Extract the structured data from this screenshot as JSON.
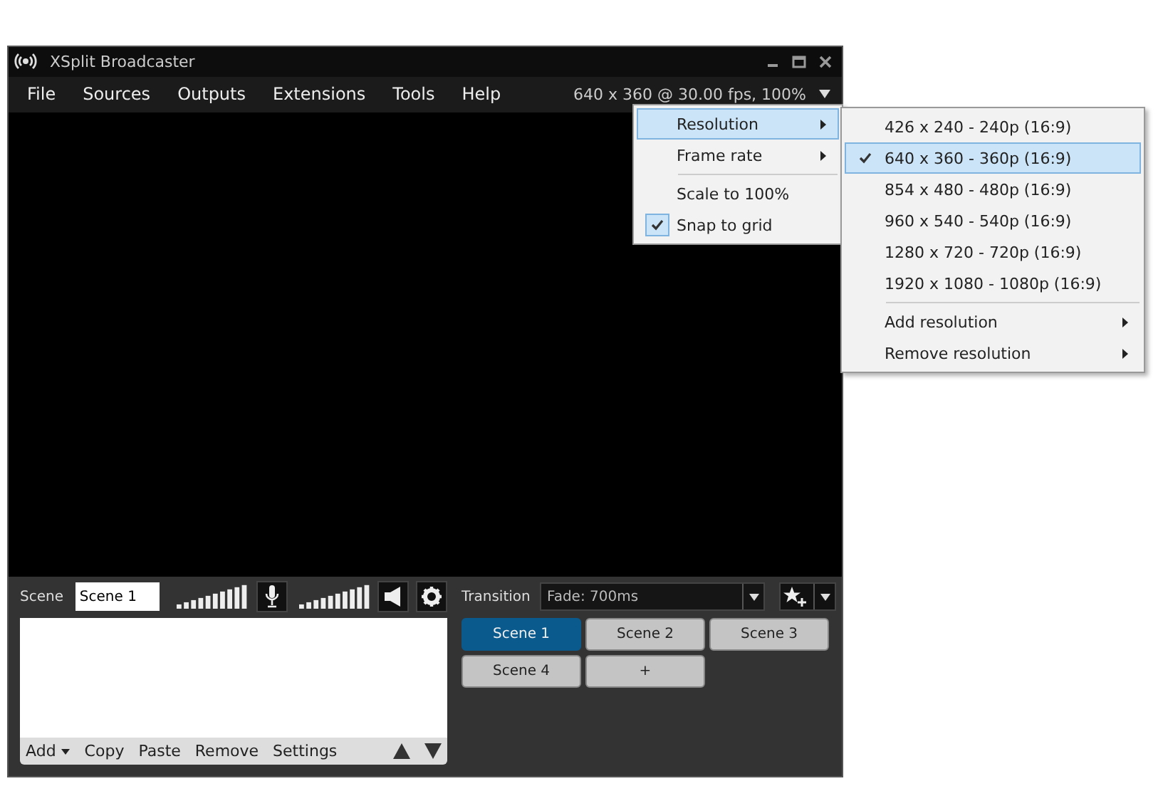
{
  "window": {
    "title": "XSplit Broadcaster"
  },
  "menu": [
    "File",
    "Sources",
    "Outputs",
    "Extensions",
    "Tools",
    "Help"
  ],
  "status": "640 x 360 @ 30.00 fps, 100%",
  "scene_bar": {
    "label": "Scene",
    "name": "Scene 1"
  },
  "sources_toolbar": [
    {
      "label": "Add",
      "kind": "dropdown"
    },
    {
      "label": "Copy",
      "kind": "plain"
    },
    {
      "label": "Paste",
      "kind": "plain"
    },
    {
      "label": "Remove",
      "kind": "plain"
    },
    {
      "label": "Settings",
      "kind": "plain"
    }
  ],
  "transition": {
    "label": "Transition",
    "value": "Fade: 700ms"
  },
  "scenes": [
    {
      "label": "Scene 1",
      "selected": true
    },
    {
      "label": "Scene 2",
      "selected": false
    },
    {
      "label": "Scene 3",
      "selected": false
    },
    {
      "label": "Scene 4",
      "selected": false
    }
  ],
  "add_scene": "+",
  "context_menu": [
    {
      "label": "Resolution",
      "kind": "submenu",
      "selected": true,
      "checked": false,
      "separator_before": false
    },
    {
      "label": "Frame rate",
      "kind": "submenu",
      "selected": false,
      "checked": false,
      "separator_before": false
    },
    {
      "label": "Scale to 100%",
      "kind": "item",
      "selected": false,
      "checked": false,
      "separator_before": true
    },
    {
      "label": "Snap to grid",
      "kind": "item",
      "selected": false,
      "checked": true,
      "separator_before": false
    }
  ],
  "resolution_menu": [
    {
      "label": "426 x 240 - 240p (16:9)",
      "kind": "item",
      "selected": false,
      "checked": false,
      "separator_before": false
    },
    {
      "label": "640 x 360 - 360p (16:9)",
      "kind": "item",
      "selected": true,
      "checked": true,
      "separator_before": false
    },
    {
      "label": "854 x 480 - 480p (16:9)",
      "kind": "item",
      "selected": false,
      "checked": false,
      "separator_before": false
    },
    {
      "label": "960 x 540 - 540p (16:9)",
      "kind": "item",
      "selected": false,
      "checked": false,
      "separator_before": false
    },
    {
      "label": "1280 x 720 - 720p (16:9)",
      "kind": "item",
      "selected": false,
      "checked": false,
      "separator_before": false
    },
    {
      "label": "1920 x 1080 - 1080p (16:9)",
      "kind": "item",
      "selected": false,
      "checked": false,
      "separator_before": false
    },
    {
      "label": "Add resolution",
      "kind": "submenu",
      "selected": false,
      "checked": false,
      "separator_before": true
    },
    {
      "label": "Remove resolution",
      "kind": "submenu",
      "selected": false,
      "checked": false,
      "separator_before": false
    }
  ]
}
